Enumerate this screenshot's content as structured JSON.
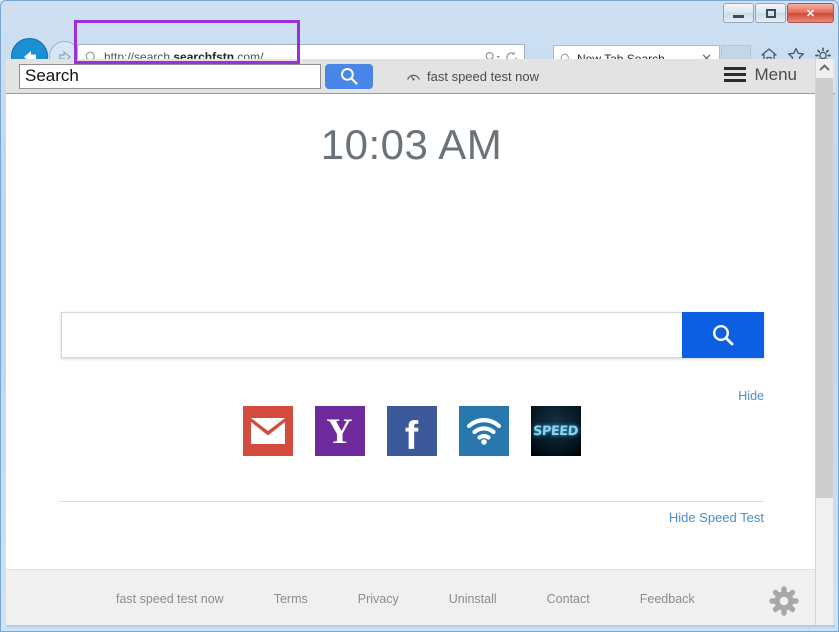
{
  "browser": {
    "window_controls": {
      "minimize": "minimize-button",
      "maximize": "maximize-button",
      "close": "✕"
    },
    "address_bar": {
      "url_prefix": "http://search.",
      "url_domain": "searchfstn",
      "url_suffix": ".com/",
      "full_url": "http://search.searchfstn.com/"
    },
    "tab": {
      "title": "New Tab Search",
      "close_label": "✕"
    }
  },
  "toolbar": {
    "search_value": "Search",
    "search_placeholder": "Search",
    "brand_link": "fast speed test now",
    "menu_label": "Menu"
  },
  "page": {
    "clock": "10:03 AM",
    "search_value": "",
    "search_placeholder": "",
    "hide_link": "Hide",
    "hide_speed_test_link": "Hide Speed Test",
    "tiles": [
      {
        "name": "gmail",
        "label": "✉",
        "color": "#d44c3d"
      },
      {
        "name": "yahoo",
        "label": "Y",
        "color": "#6e2a9c"
      },
      {
        "name": "facebook",
        "label": "f",
        "color": "#3b5998"
      },
      {
        "name": "wifi",
        "label": "wifi-icon",
        "color": "#2878ad"
      },
      {
        "name": "speed",
        "label": "SPEED",
        "color": "#05131d"
      }
    ],
    "footer_links": [
      "fast speed test now",
      "Terms",
      "Privacy",
      "Uninstall",
      "Contact",
      "Feedback"
    ]
  },
  "colors": {
    "accent_blue": "#0b5fe0",
    "toolbar_blue": "#4a86e8",
    "link_blue": "#4b8ccb",
    "highlight_purple": "#9b30d9",
    "clock_gray": "#6b7278"
  }
}
